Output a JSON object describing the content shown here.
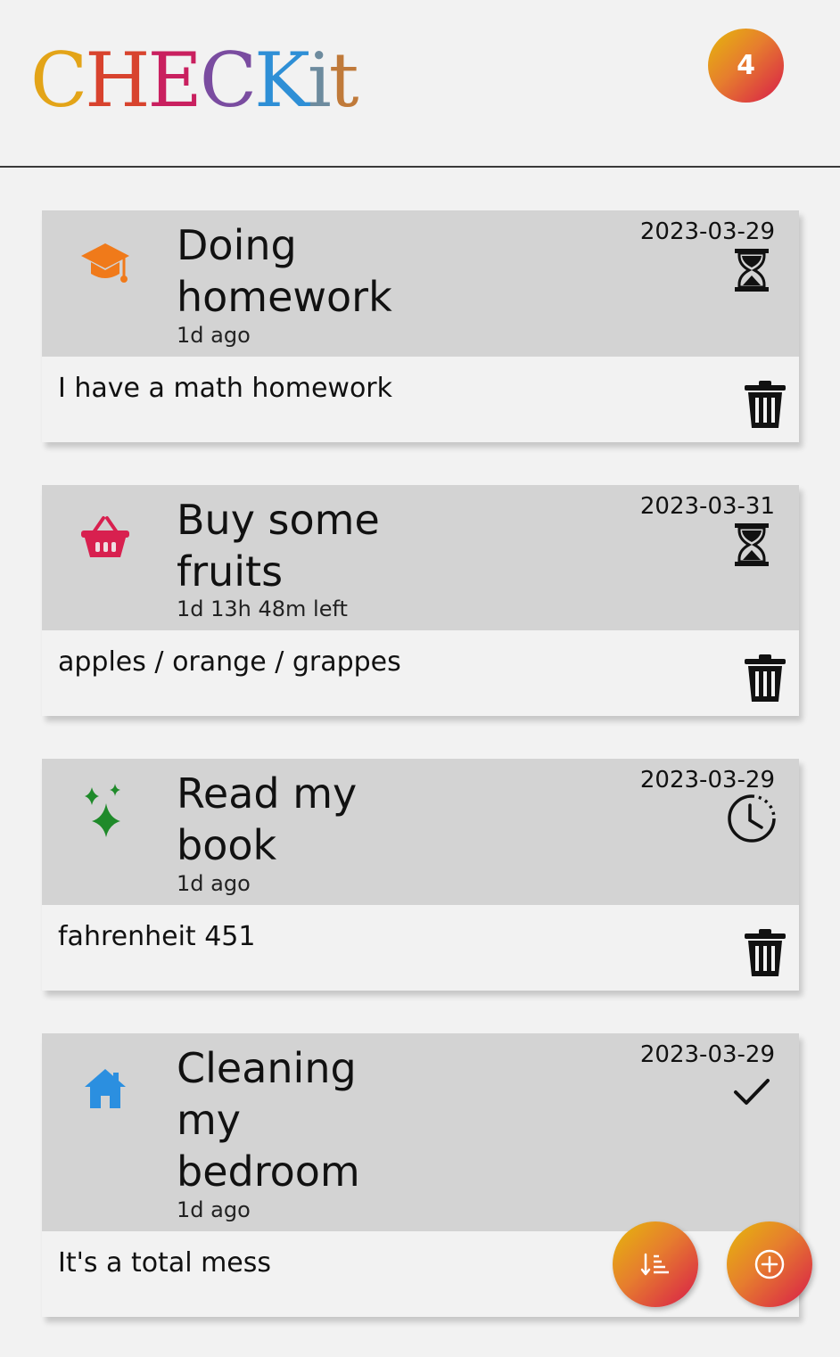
{
  "app": {
    "logo_letters": [
      {
        "ch": "C",
        "color": "#e3a418"
      },
      {
        "ch": "H",
        "color": "#d8432e"
      },
      {
        "ch": "E",
        "color": "#c9205f"
      },
      {
        "ch": "C",
        "color": "#7a4ca0"
      },
      {
        "ch": "K",
        "color": "#2e8fd6"
      },
      {
        "ch": "i",
        "color": "#6d8b9e"
      },
      {
        "ch": "t",
        "color": "#c07a3a"
      }
    ],
    "task_count": "4"
  },
  "tasks": [
    {
      "title": "Doing homework",
      "time": "1d ago",
      "date": "2023-03-29",
      "description": "I have a math homework",
      "category_icon": "graduation-cap-icon",
      "category_color": "#f07a1a",
      "status_icon": "hourglass-icon"
    },
    {
      "title": "Buy some fruits",
      "time": "1d 13h 48m left",
      "date": "2023-03-31",
      "description": "apples / orange / grappes",
      "category_icon": "basket-icon",
      "category_color": "#d8204f",
      "status_icon": "hourglass-icon"
    },
    {
      "title": "Read my book",
      "time": "1d ago",
      "date": "2023-03-29",
      "description": "fahrenheit 451",
      "category_icon": "sparkles-icon",
      "category_color": "#1f8a2a",
      "status_icon": "clock-icon"
    },
    {
      "title": "Cleaning my bedroom",
      "time": "1d ago",
      "date": "2023-03-29",
      "description": "It's a total mess",
      "category_icon": "house-icon",
      "category_color": "#2b8fe0",
      "status_icon": "checkmark-icon"
    }
  ],
  "fab": {
    "sort_icon": "sort-icon",
    "add_icon": "add-circle-icon"
  },
  "colors": {
    "accent_gradient_start": "#e5b80b",
    "accent_gradient_end": "#d81b4a",
    "card_header_bg": "#d3d3d3",
    "page_bg": "#f2f2f2"
  }
}
